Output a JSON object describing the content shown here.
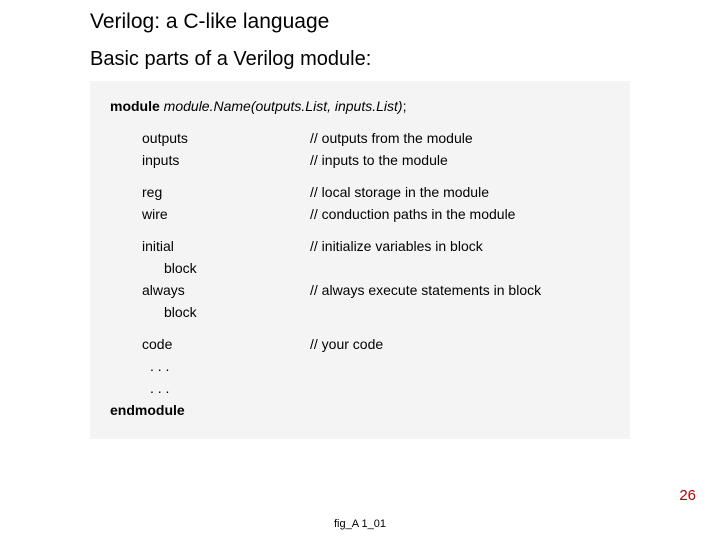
{
  "title": "Verilog:  a C-like language",
  "subtitle": "Basic parts of a Verilog module:",
  "code": {
    "module_kw": "module",
    "module_name": "module.Name(outputs.List, inputs.List)",
    "semicolon": ";",
    "outputs_kw": "outputs",
    "outputs_comment": "// outputs from the module",
    "inputs_kw": "inputs",
    "inputs_comment": "// inputs to the module",
    "reg_kw": "reg",
    "reg_comment": "// local storage in the module",
    "wire_kw": "wire",
    "wire_comment": "// conduction paths in the module",
    "initial_kw": "initial",
    "initial_comment": "// initialize variables in block",
    "block1": "block",
    "always_kw": "always",
    "always_comment": "// always execute statements in block",
    "block2": "block",
    "code_kw": "code",
    "code_comment": "// your code",
    "dots1": ". . .",
    "dots2": ". . .",
    "endmodule_kw": "endmodule"
  },
  "page_number": "26",
  "figure_label": "fig_A 1_01"
}
